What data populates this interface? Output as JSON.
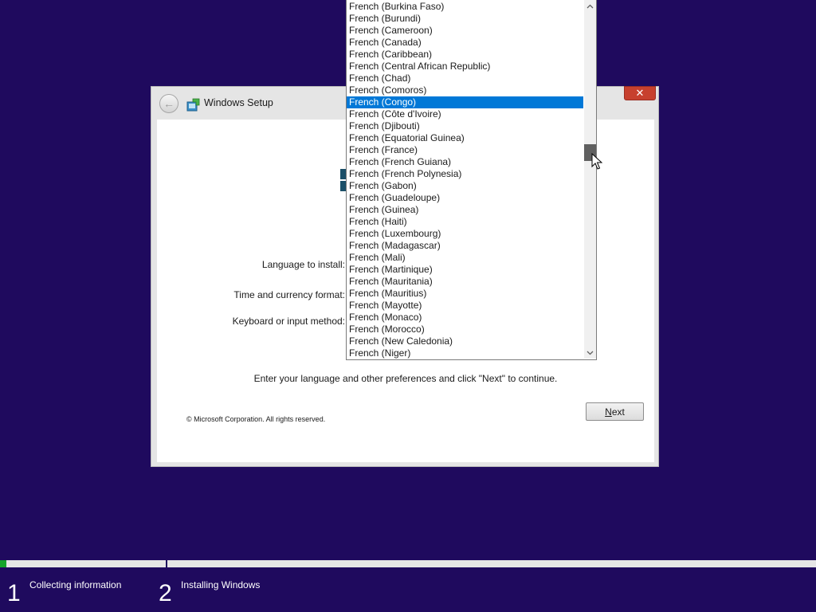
{
  "window": {
    "title": "Windows Setup",
    "back_icon": "back-arrow-icon",
    "close_symbol": "✕",
    "labels": {
      "language": "Language to install:",
      "time_currency": "Time and currency format:",
      "keyboard": "Keyboard or input method:"
    },
    "instruction": "Enter your language and other preferences and click \"Next\" to continue.",
    "copyright": "© Microsoft Corporation. All rights reserved.",
    "next_button": {
      "prefix": "",
      "underlined": "N",
      "rest": "ext"
    }
  },
  "dropdown": {
    "selected_index": 8,
    "options": [
      "French (Burkina Faso)",
      "French (Burundi)",
      "French (Cameroon)",
      "French (Canada)",
      "French (Caribbean)",
      "French (Central African Republic)",
      "French (Chad)",
      "French (Comoros)",
      "French (Congo)",
      "French (Côte d'Ivoire)",
      "French (Djibouti)",
      "French (Equatorial Guinea)",
      "French (France)",
      "French (French Guiana)",
      "French (French Polynesia)",
      "French (Gabon)",
      "French (Guadeloupe)",
      "French (Guinea)",
      "French (Haiti)",
      "French (Luxembourg)",
      "French (Madagascar)",
      "French (Mali)",
      "French (Martinique)",
      "French (Mauritania)",
      "French (Mauritius)",
      "French (Mayotte)",
      "French (Monaco)",
      "French (Morocco)",
      "French (New Caledonia)",
      "French (Niger)"
    ],
    "scroll_up_icon": "chevron-up-icon",
    "scroll_down_icon": "chevron-down-icon"
  },
  "progress": {
    "steps": [
      {
        "number": "1",
        "label": "Collecting information"
      },
      {
        "number": "2",
        "label": "Installing Windows"
      }
    ],
    "fill_fraction": 0.008
  },
  "colors": {
    "background": "#1f0a5e",
    "selection": "#0078d7",
    "progress": "#16a52b",
    "close_button": "#c7402e"
  }
}
